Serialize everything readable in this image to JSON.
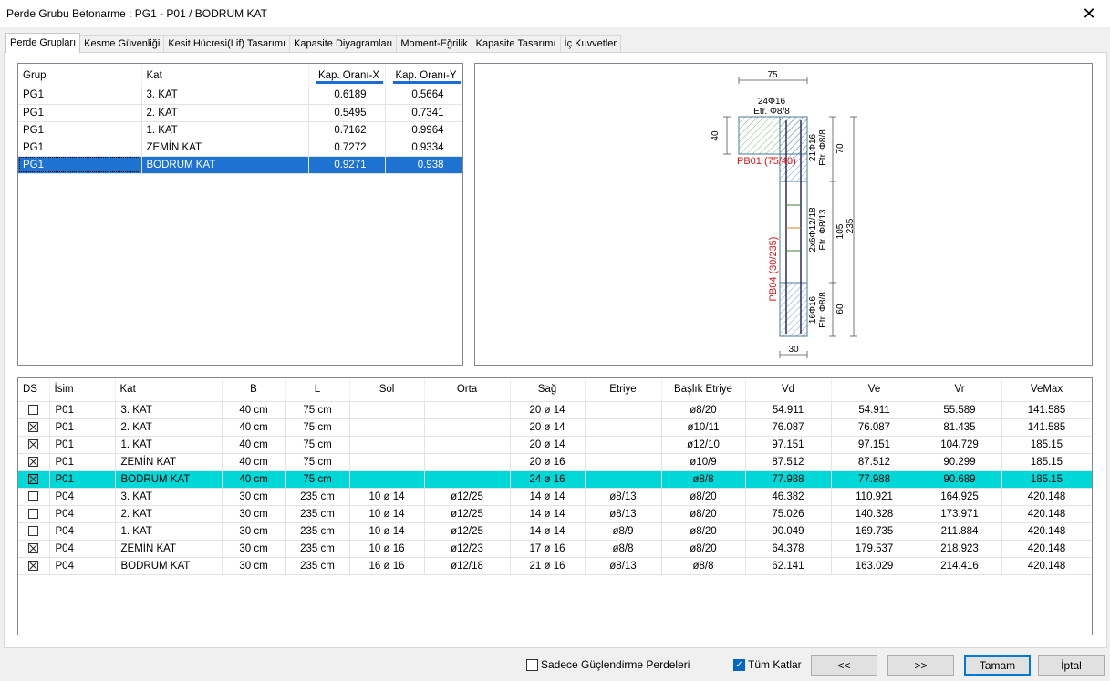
{
  "window": {
    "title": "Perde Grubu Betonarme  :  PG1 - P01 / BODRUM KAT",
    "close": "✕"
  },
  "tabs": [
    "Perde Grupları",
    "Kesme Güvenliği",
    "Kesit Hücresi(Lif) Tasarımı",
    "Kapasite Diyagramları",
    "Moment-Eğrilik",
    "Kapasite Tasarımı",
    "İç Kuvvetler"
  ],
  "group_grid": {
    "headers": [
      "Grup",
      "Kat",
      "Kap. Oranı-X",
      "Kap. Oranı-Y"
    ],
    "rows": [
      [
        "PG1",
        "3. KAT",
        "0.6189",
        "0.5664"
      ],
      [
        "PG1",
        "2. KAT",
        "0.5495",
        "0.7341"
      ],
      [
        "PG1",
        "1. KAT",
        "0.7162",
        "0.9964"
      ],
      [
        "PG1",
        "ZEMİN KAT",
        "0.7272",
        "0.9334"
      ],
      [
        "PG1",
        "BODRUM KAT",
        "0.9271",
        "0.938"
      ]
    ],
    "selected_index": 4
  },
  "drawing": {
    "dim_top": "75",
    "top_rebar": "24Φ16",
    "top_stirrup": "Etr. Φ8/8",
    "dim_40": "40",
    "label_pb01": "PB01 (75/40)",
    "label_pb04": "PB04 (30/235)",
    "right_1a": "21Φ16",
    "right_1b": "Etr. Φ8/8",
    "right_2a": "2x6Φ12/18",
    "right_2b": "Etr. Φ8/13",
    "right_3a": "16Φ16",
    "right_3b": "Etr. Φ8/8",
    "dim_70": "70",
    "dim_105": "105",
    "dim_60": "60",
    "dim_235": "235",
    "dim_bottom": "30",
    "red_color": "#e01010"
  },
  "pier_grid": {
    "headers": [
      "DS",
      "İsim",
      "Kat",
      "B",
      "L",
      "Sol",
      "Orta",
      "Sağ",
      "Etriye",
      "Başlık Etriye",
      "Vd",
      "Ve",
      "Vr",
      "VeMax"
    ],
    "rows": [
      {
        "ds": false,
        "cells": [
          "P01",
          "3. KAT",
          "40 cm",
          "75 cm",
          "",
          "",
          "20 ø 14",
          "",
          "ø8/20",
          "54.911",
          "54.911",
          "55.589",
          "141.585"
        ]
      },
      {
        "ds": true,
        "cells": [
          "P01",
          "2. KAT",
          "40 cm",
          "75 cm",
          "",
          "",
          "20 ø 14",
          "",
          "ø10/11",
          "76.087",
          "76.087",
          "81.435",
          "141.585"
        ]
      },
      {
        "ds": true,
        "cells": [
          "P01",
          "1. KAT",
          "40 cm",
          "75 cm",
          "",
          "",
          "20 ø 14",
          "",
          "ø12/10",
          "97.151",
          "97.151",
          "104.729",
          "185.15"
        ]
      },
      {
        "ds": true,
        "cells": [
          "P01",
          "ZEMİN KAT",
          "40 cm",
          "75 cm",
          "",
          "",
          "20 ø 16",
          "",
          "ø10/9",
          "87.512",
          "87.512",
          "90.299",
          "185.15"
        ]
      },
      {
        "ds": true,
        "cells": [
          "P01",
          "BODRUM KAT",
          "40 cm",
          "75 cm",
          "",
          "",
          "24 ø 16",
          "",
          "ø8/8",
          "77.988",
          "77.988",
          "90.689",
          "185.15"
        ],
        "selected": true
      },
      {
        "ds": false,
        "cells": [
          "P04",
          "3. KAT",
          "30 cm",
          "235 cm",
          "10 ø 14",
          "ø12/25",
          "14 ø 14",
          "ø8/13",
          "ø8/20",
          "46.382",
          "110.921",
          "164.925",
          "420.148"
        ]
      },
      {
        "ds": false,
        "cells": [
          "P04",
          "2. KAT",
          "30 cm",
          "235 cm",
          "10 ø 14",
          "ø12/25",
          "14 ø 14",
          "ø8/13",
          "ø8/20",
          "75.026",
          "140.328",
          "173.971",
          "420.148"
        ]
      },
      {
        "ds": false,
        "cells": [
          "P04",
          "1. KAT",
          "30 cm",
          "235 cm",
          "10 ø 14",
          "ø12/25",
          "14 ø 14",
          "ø8/9",
          "ø8/20",
          "90.049",
          "169.735",
          "211.884",
          "420.148"
        ]
      },
      {
        "ds": true,
        "cells": [
          "P04",
          "ZEMİN KAT",
          "30 cm",
          "235 cm",
          "10 ø 16",
          "ø12/23",
          "17 ø 16",
          "ø8/8",
          "ø8/20",
          "64.378",
          "179.537",
          "218.923",
          "420.148"
        ]
      },
      {
        "ds": true,
        "cells": [
          "P04",
          "BODRUM KAT",
          "30 cm",
          "235 cm",
          "16 ø 16",
          "ø12/18",
          "21 ø 16",
          "ø8/13",
          "ø8/8",
          "62.141",
          "163.029",
          "214.416",
          "420.148"
        ]
      }
    ]
  },
  "footer": {
    "only_strengthen_label": "Sadece Güçlendirme Perdeleri",
    "only_strengthen_checked": false,
    "all_floors_label": "Tüm Katlar",
    "all_floors_checked": true,
    "prev": "<<",
    "next": ">>",
    "ok": "Tamam",
    "cancel": "İptal"
  }
}
